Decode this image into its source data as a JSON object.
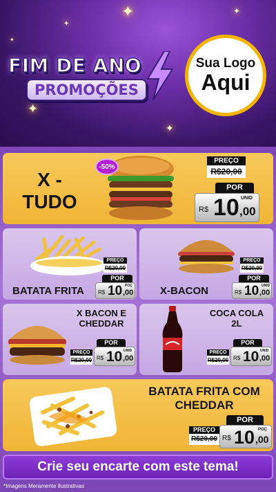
{
  "header": {
    "title_line1": "FIM DE ANO",
    "title_line2": "PROMOÇÕES",
    "logo_line1": "Sua Logo",
    "logo_line2": "Aqui"
  },
  "products": [
    {
      "name": "X - TUDO",
      "old_label": "PREÇO",
      "old_price": "R$20,00",
      "new_label": "POR",
      "currency": "R$",
      "price_int": "10",
      "price_cents": ",00",
      "unit": "UNID",
      "discount": "-50%"
    },
    {
      "name": "BATATA FRITA",
      "old_label": "PREÇO",
      "old_price": "R$20,00",
      "new_label": "POR",
      "currency": "R$",
      "price_int": "10",
      "price_cents": ",00",
      "unit": "POÇ"
    },
    {
      "name": "X-BACON",
      "old_label": "PREÇO",
      "old_price": "R$20,00",
      "new_label": "POR",
      "currency": "R$",
      "price_int": "10",
      "price_cents": ",00",
      "unit": "UNID"
    },
    {
      "name": "X BACON E CHEDDAR",
      "old_label": "PREÇO",
      "old_price": "R$20,00",
      "new_label": "POR",
      "currency": "R$",
      "price_int": "10",
      "price_cents": ",00",
      "unit": "UNID"
    },
    {
      "name": "COCA COLA 2L",
      "old_label": "PREÇO",
      "old_price": "R$20,00",
      "new_label": "POR",
      "currency": "R$",
      "price_int": "10",
      "price_cents": ",00",
      "unit": "UNID"
    },
    {
      "name": "BATATA FRITA COM CHEDDAR",
      "old_label": "PREÇO",
      "old_price": "R$20,00",
      "new_label": "POR",
      "currency": "R$",
      "price_int": "10",
      "price_cents": ",00",
      "unit": "POÇ"
    }
  ],
  "footer": {
    "cta_label": "Crie seu encarte com este tema!",
    "disclaimer": "*Imagens Meramente Ilustrativas"
  },
  "colors": {
    "accent_yellow": "#f0b93a",
    "background_purple": "#7d45b8",
    "logo_border": "#f4b400"
  },
  "icons": [
    "sparkle-icon",
    "lightning-bolt-icon"
  ]
}
